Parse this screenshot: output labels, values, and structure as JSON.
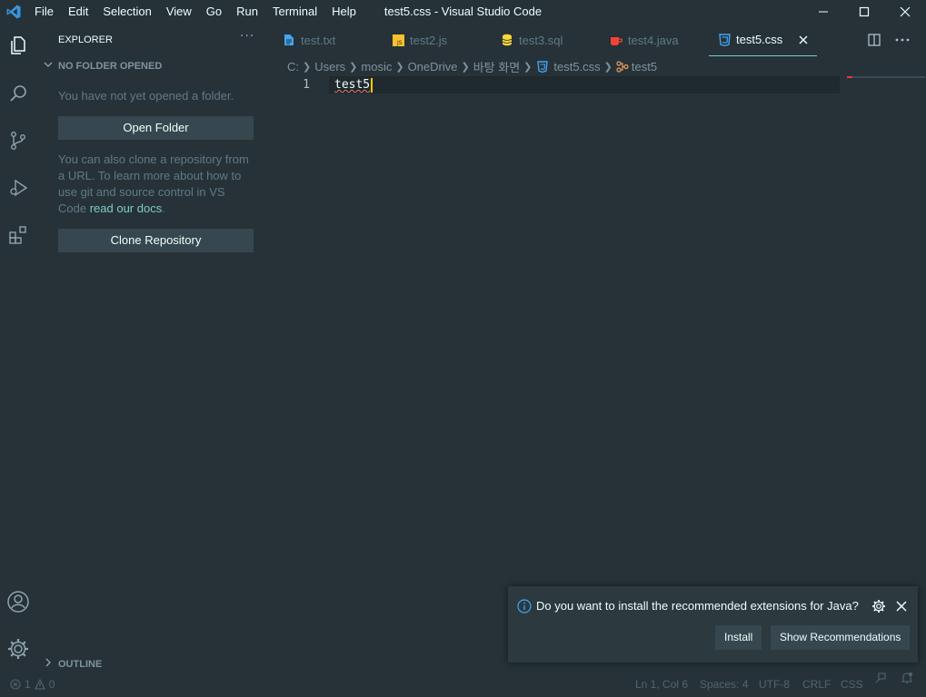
{
  "titlebar": {
    "menu": [
      "File",
      "Edit",
      "Selection",
      "View",
      "Go",
      "Run",
      "Terminal",
      "Help"
    ],
    "window_title": "test5.css - Visual Studio Code",
    "accent": "#3a96dd"
  },
  "sidebar": {
    "title": "EXPLORER",
    "more": "···",
    "section": "NO FOLDER OPENED",
    "no_folder_text": "You have not yet opened a folder.",
    "open_folder_label": "Open Folder",
    "clone_text_lines": [
      "You can also clone a repository from",
      "a URL. To learn more about how to",
      "use git and source control in VS"
    ],
    "clone_text_tail": "Code ",
    "docs_link": "read our docs",
    "docs_period": ".",
    "clone_repo_label": "Clone Repository",
    "outline": "OUTLINE"
  },
  "tabs": [
    {
      "label": "test.txt",
      "icon": "file-text-icon",
      "active": false
    },
    {
      "label": "test2.js",
      "icon": "js-icon",
      "active": false
    },
    {
      "label": "test3.sql",
      "icon": "database-icon",
      "active": false
    },
    {
      "label": "test4.java",
      "icon": "java-icon",
      "active": false
    },
    {
      "label": "test5.css",
      "icon": "css-icon",
      "active": true
    }
  ],
  "breadcrumb": {
    "parts": [
      "C:",
      "Users",
      "mosic",
      "OneDrive",
      "바탕 화면"
    ],
    "file": "test5.css",
    "symbol": "test5"
  },
  "editor": {
    "line_number": "1",
    "code": "test5"
  },
  "notification": {
    "message": "Do you want to install the recommended extensions for Java?",
    "install_label": "Install",
    "show_label": "Show Recommendations"
  },
  "statusbar": {
    "errors": "1",
    "warnings": "0",
    "position": "Ln 1, Col 6",
    "spaces": "Spaces: 4",
    "encoding": "UTF-8",
    "eol": "CRLF",
    "language": "CSS"
  },
  "colors": {
    "background": "#263238",
    "accent_teal": "#80cbc4",
    "css_icon": "#42a5f5",
    "js_icon": "#fbc02d",
    "java_icon": "#f44336",
    "sql_icon": "#fdd835"
  }
}
